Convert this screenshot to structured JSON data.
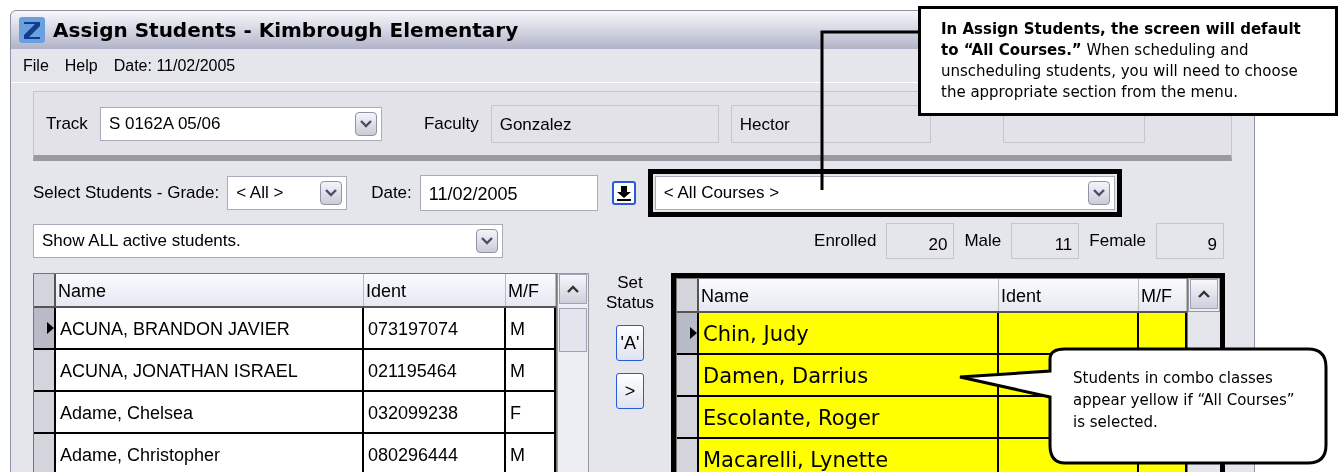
{
  "window": {
    "title": "Assign Students - Kimbrough Elementary"
  },
  "menu": [
    {
      "label": "File"
    },
    {
      "label": "Help"
    },
    {
      "label": "Date: 11/02/2005"
    }
  ],
  "track": {
    "label": "Track",
    "value": "S 0162A 05/06"
  },
  "faculty": {
    "label": "Faculty",
    "last_name": "Gonzalez",
    "first_name": "Hector"
  },
  "filters": {
    "grade_label": "Select Students - Grade:",
    "grade": "< All >",
    "date_label": "Date:",
    "date": "11/02/2005",
    "course": "< All Courses >",
    "show": "Show ALL active students."
  },
  "counts": [
    {
      "label": "Enrolled",
      "value": "20"
    },
    {
      "label": "Male",
      "value": "11"
    },
    {
      "label": "Female",
      "value": "9"
    }
  ],
  "available_table": {
    "columns": [
      "Name",
      "Ident",
      "M/F"
    ],
    "rows": [
      {
        "name": "ACUNA, BRANDON JAVIER",
        "ident": "073197074",
        "mf": "M",
        "selected": true
      },
      {
        "name": "ACUNA, JONATHAN ISRAEL",
        "ident": "021195464",
        "mf": "M",
        "selected": false
      },
      {
        "name": "Adame, Chelsea",
        "ident": "032099238",
        "mf": "F",
        "selected": false
      },
      {
        "name": "Adame, Christopher",
        "ident": "080296444",
        "mf": "M",
        "selected": false
      }
    ]
  },
  "set_status": {
    "label": "Set Status",
    "buttons": [
      "'A'",
      ">"
    ]
  },
  "assigned_table": {
    "columns": [
      "Name",
      "Ident",
      "M/F"
    ],
    "rows": [
      {
        "name": "Chin, Judy",
        "selected": true,
        "combo": true
      },
      {
        "name": "Damen, Darrius",
        "selected": false,
        "combo": true
      },
      {
        "name": "Escolante, Roger",
        "selected": false,
        "combo": true
      },
      {
        "name": "Macarelli, Lynette",
        "selected": false,
        "combo": true
      }
    ]
  },
  "callouts": [
    {
      "kind": "note",
      "bold": "In Assign Students, the screen will default to “All Courses.”",
      "text": "When scheduling and unscheduling students, you will need to choose the appropriate section from the menu."
    },
    {
      "kind": "bubble",
      "text": "Students in combo classes appear yellow if “All Courses” is selected."
    }
  ]
}
